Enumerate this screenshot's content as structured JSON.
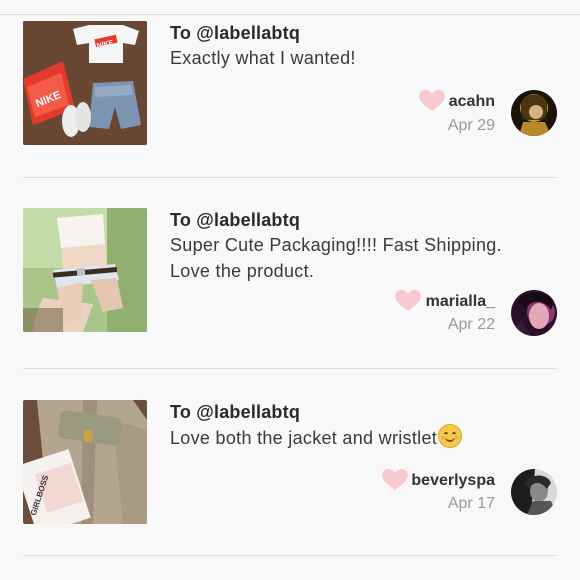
{
  "reviews": [
    {
      "to_label": "To @labellabtq",
      "message": "Exactly what I wanted!",
      "username": "acahn",
      "date": "Apr 29",
      "has_emoji": false
    },
    {
      "to_label": "To @labellabtq",
      "message": "Super Cute Packaging!!!! Fast Shipping. Love the product.",
      "username": "marialla_",
      "date": "Apr 22",
      "has_emoji": false
    },
    {
      "to_label": "To @labellabtq",
      "message": "Love both the jacket and wristlet",
      "username": "beverlyspa",
      "date": "Apr 17",
      "has_emoji": true
    }
  ],
  "photo1_box_text": "NIKE",
  "photo1_shirt_text": "NIKE",
  "photo3_book_text": "GIRLBOSS",
  "colors": {
    "heart": "#f8c9cf",
    "divider": "#dedede",
    "date": "#9a9a9a"
  }
}
